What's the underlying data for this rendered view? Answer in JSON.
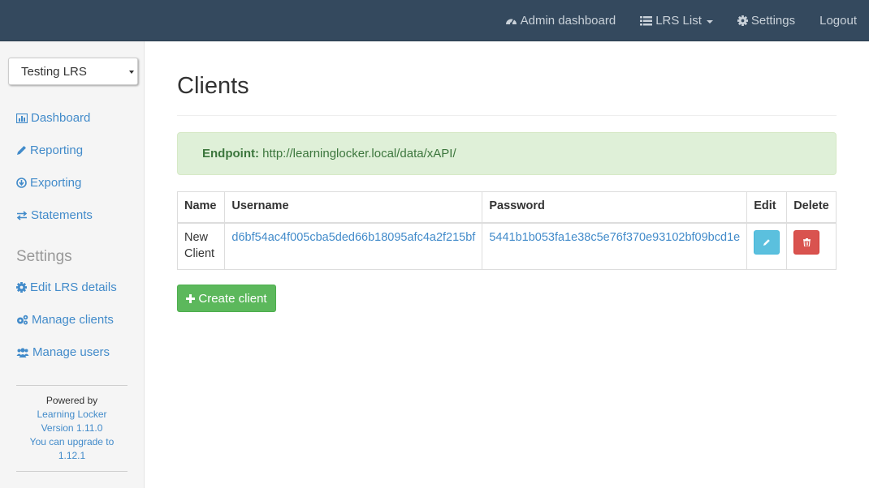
{
  "navbar": {
    "admin_dashboard": "Admin dashboard",
    "lrs_list": "LRS List",
    "settings": "Settings",
    "logout": "Logout"
  },
  "sidebar": {
    "lrs_selected": "Testing LRS",
    "nav": [
      {
        "label": "Dashboard",
        "icon": "bar-chart-icon"
      },
      {
        "label": "Reporting",
        "icon": "pencil-icon"
      },
      {
        "label": "Exporting",
        "icon": "download-circle-icon"
      },
      {
        "label": "Statements",
        "icon": "exchange-arrows-icon"
      }
    ],
    "settings_heading": "Settings",
    "settings_nav": [
      {
        "label": "Edit LRS details",
        "icon": "gear-icon"
      },
      {
        "label": "Manage clients",
        "icon": "gears-icon"
      },
      {
        "label": "Manage users",
        "icon": "users-icon"
      }
    ],
    "footer": {
      "powered_by": "Powered by",
      "product": "Learning Locker",
      "version": "Version 1.11.0",
      "upgrade_line1": "You can upgrade to",
      "upgrade_line2": "1.12.1"
    }
  },
  "main": {
    "title": "Clients",
    "endpoint_label": "Endpoint:",
    "endpoint_url": "http://learninglocker.local/data/xAPI/",
    "table": {
      "headers": [
        "Name",
        "Username",
        "Password",
        "Edit",
        "Delete"
      ],
      "rows": [
        {
          "name_line1": "New",
          "name_line2": "Client",
          "username": "d6bf54ac4f005cba5ded66b18095afc4a2f215bf",
          "password": "5441b1b053fa1e38c5e76f370e93102bf09bcd1e"
        }
      ]
    },
    "create_button": "Create client"
  },
  "colors": {
    "navbar_bg": "#34495e",
    "link": "#428bca",
    "success_bg": "#dff0d8",
    "success_text": "#3c763d",
    "edit_button": "#5bc0de",
    "delete_button": "#d9534f",
    "create_button": "#5cb85c"
  }
}
